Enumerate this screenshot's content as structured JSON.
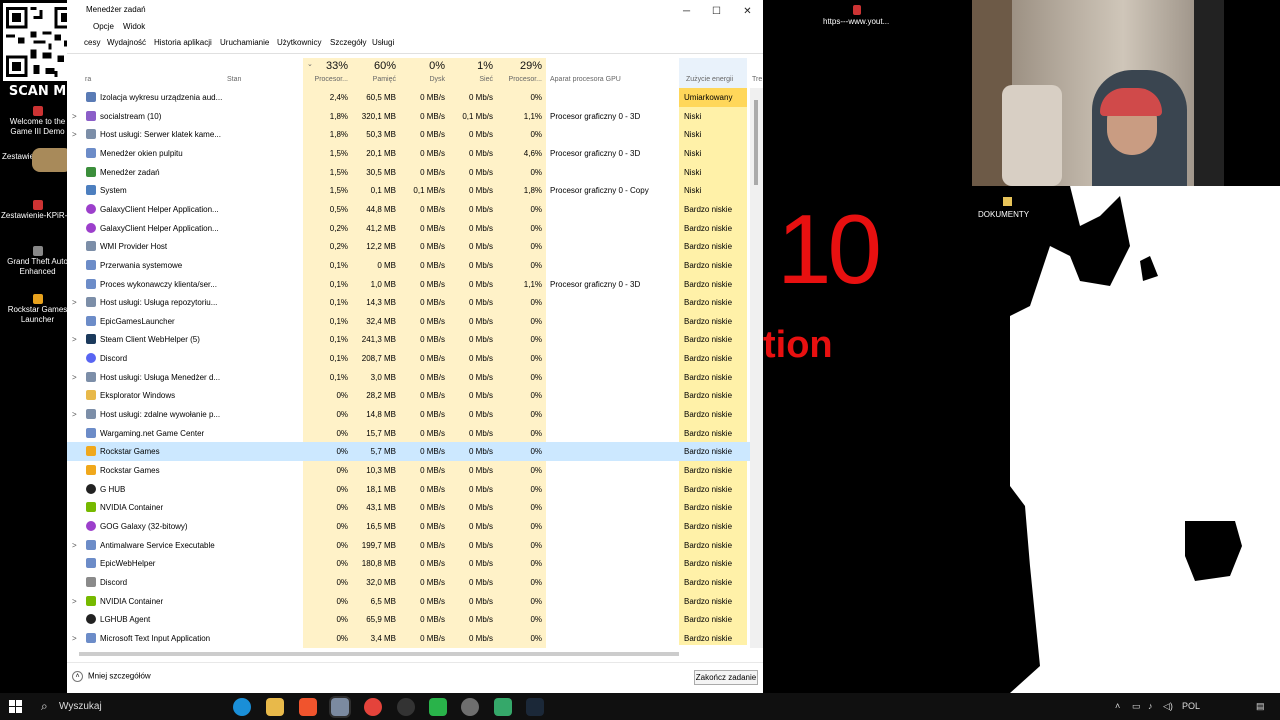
{
  "desktop": {
    "scan_text": "SCAN ME",
    "icons": [
      {
        "label": "Welcome to the Game III Demo"
      },
      {
        "label": "Zestawienie"
      },
      {
        "label": "Zestawienie-KPiR-..."
      },
      {
        "label": "Grand Theft Auto Enhanced"
      },
      {
        "label": "Rockstar Games Launcher"
      }
    ]
  },
  "window": {
    "title": "Menedżer zadań",
    "menu": [
      "Opcje",
      "Widok"
    ],
    "tabs": [
      "cesy",
      "Wydajność",
      "Historia aplikacji",
      "Uruchamianie",
      "Użytkownicy",
      "Szczegóły",
      "Usługi"
    ],
    "column_headers": {
      "name": "ra",
      "status": "Stan",
      "cpu_pct": "33%",
      "cpu": "Procesor...",
      "mem_pct": "60%",
      "mem": "Pamięć",
      "disk_pct": "0%",
      "disk": "Dysk",
      "net_pct": "1%",
      "net": "Sieć",
      "gpu_pct": "29%",
      "gpu": "Procesor...",
      "gpu_engine": "Aparat procesora GPU",
      "power": "Zużycie energii",
      "power2": "Tre"
    },
    "rows": [
      {
        "expand": "",
        "name": "Izolacja wykresu urządzenia aud...",
        "cpu": "2,4%",
        "mem": "60,5 MB",
        "disk": "0 MB/s",
        "net": "0 Mb/s",
        "gpu": "0%",
        "engine": "",
        "power": "Umiarkowany",
        "icon": "audio"
      },
      {
        "expand": ">",
        "name": "socialstream (10)",
        "cpu": "1,8%",
        "mem": "320,1 MB",
        "disk": "0 MB/s",
        "net": "0,1 Mb/s",
        "gpu": "1,1%",
        "engine": "Procesor graficzny 0 - 3D",
        "power": "Niski",
        "icon": "app"
      },
      {
        "expand": ">",
        "name": "Host usługi: Serwer klatek kame...",
        "cpu": "1,8%",
        "mem": "50,3 MB",
        "disk": "0 MB/s",
        "net": "0 Mb/s",
        "gpu": "0%",
        "engine": "",
        "power": "Niski",
        "icon": "service"
      },
      {
        "expand": "",
        "name": "Menedżer okien pulpitu",
        "cpu": "1,5%",
        "mem": "20,1 MB",
        "disk": "0 MB/s",
        "net": "0 Mb/s",
        "gpu": "4,6%",
        "engine": "Procesor graficzny 0 - 3D",
        "power": "Niski",
        "icon": "window"
      },
      {
        "expand": "",
        "name": "Menedżer zadań",
        "cpu": "1,5%",
        "mem": "30,5 MB",
        "disk": "0 MB/s",
        "net": "0 Mb/s",
        "gpu": "0%",
        "engine": "",
        "power": "Niski",
        "icon": "taskmgr"
      },
      {
        "expand": "",
        "name": "System",
        "cpu": "1,5%",
        "mem": "0,1 MB",
        "disk": "0,1 MB/s",
        "net": "0 Mb/s",
        "gpu": "1,8%",
        "engine": "Procesor graficzny 0 - Copy",
        "power": "Niski",
        "icon": "system"
      },
      {
        "expand": "",
        "name": "GalaxyClient Helper Application...",
        "cpu": "0,5%",
        "mem": "44,8 MB",
        "disk": "0 MB/s",
        "net": "0 Mb/s",
        "gpu": "0%",
        "engine": "",
        "power": "Bardzo niskie",
        "icon": "galaxy"
      },
      {
        "expand": "",
        "name": "GalaxyClient Helper Application...",
        "cpu": "0,2%",
        "mem": "41,2 MB",
        "disk": "0 MB/s",
        "net": "0 Mb/s",
        "gpu": "0%",
        "engine": "",
        "power": "Bardzo niskie",
        "icon": "galaxy"
      },
      {
        "expand": "",
        "name": "WMI Provider Host",
        "cpu": "0,2%",
        "mem": "12,2 MB",
        "disk": "0 MB/s",
        "net": "0 Mb/s",
        "gpu": "0%",
        "engine": "",
        "power": "Bardzo niskie",
        "icon": "service"
      },
      {
        "expand": "",
        "name": "Przerwania systemowe",
        "cpu": "0,1%",
        "mem": "0 MB",
        "disk": "0 MB/s",
        "net": "0 Mb/s",
        "gpu": "0%",
        "engine": "",
        "power": "Bardzo niskie",
        "icon": "window"
      },
      {
        "expand": "",
        "name": "Proces wykonawczy klienta/ser...",
        "cpu": "0,1%",
        "mem": "1,0 MB",
        "disk": "0 MB/s",
        "net": "0 Mb/s",
        "gpu": "1,1%",
        "engine": "Procesor graficzny 0 - 3D",
        "power": "Bardzo niskie",
        "icon": "window"
      },
      {
        "expand": ">",
        "name": "Host usługi: Usługa repozytoriu...",
        "cpu": "0,1%",
        "mem": "14,3 MB",
        "disk": "0 MB/s",
        "net": "0 Mb/s",
        "gpu": "0%",
        "engine": "",
        "power": "Bardzo niskie",
        "icon": "service"
      },
      {
        "expand": "",
        "name": "EpicGamesLauncher",
        "cpu": "0,1%",
        "mem": "32,4 MB",
        "disk": "0 MB/s",
        "net": "0 Mb/s",
        "gpu": "0%",
        "engine": "",
        "power": "Bardzo niskie",
        "icon": "window"
      },
      {
        "expand": ">",
        "name": "Steam Client WebHelper (5)",
        "cpu": "0,1%",
        "mem": "241,3 MB",
        "disk": "0 MB/s",
        "net": "0 Mb/s",
        "gpu": "0%",
        "engine": "",
        "power": "Bardzo niskie",
        "icon": "steam"
      },
      {
        "expand": "",
        "name": "Discord",
        "cpu": "0,1%",
        "mem": "208,7 MB",
        "disk": "0 MB/s",
        "net": "0 Mb/s",
        "gpu": "0%",
        "engine": "",
        "power": "Bardzo niskie",
        "icon": "discord"
      },
      {
        "expand": ">",
        "name": "Host usługi: Usługa Menedżer d...",
        "cpu": "0,1%",
        "mem": "3,0 MB",
        "disk": "0 MB/s",
        "net": "0 Mb/s",
        "gpu": "0%",
        "engine": "",
        "power": "Bardzo niskie",
        "icon": "service"
      },
      {
        "expand": "",
        "name": "Eksplorator Windows",
        "cpu": "0%",
        "mem": "28,2 MB",
        "disk": "0 MB/s",
        "net": "0 Mb/s",
        "gpu": "0%",
        "engine": "",
        "power": "Bardzo niskie",
        "icon": "folder"
      },
      {
        "expand": ">",
        "name": "Host usługi: zdalne wywołanie p...",
        "cpu": "0%",
        "mem": "14,8 MB",
        "disk": "0 MB/s",
        "net": "0 Mb/s",
        "gpu": "0%",
        "engine": "",
        "power": "Bardzo niskie",
        "icon": "service"
      },
      {
        "expand": "",
        "name": "Wargaming.net Game Center",
        "cpu": "0%",
        "mem": "15,7 MB",
        "disk": "0 MB/s",
        "net": "0 Mb/s",
        "gpu": "0%",
        "engine": "",
        "power": "Bardzo niskie",
        "icon": "window"
      },
      {
        "expand": "",
        "name": "Rockstar Games",
        "cpu": "0%",
        "mem": "5,7 MB",
        "disk": "0 MB/s",
        "net": "0 Mb/s",
        "gpu": "0%",
        "engine": "",
        "power": "Bardzo niskie",
        "icon": "rockstar",
        "selected": true
      },
      {
        "expand": "",
        "name": "Rockstar Games",
        "cpu": "0%",
        "mem": "10,3 MB",
        "disk": "0 MB/s",
        "net": "0 Mb/s",
        "gpu": "0%",
        "engine": "",
        "power": "Bardzo niskie",
        "icon": "rockstar"
      },
      {
        "expand": "",
        "name": "G HUB",
        "cpu": "0%",
        "mem": "18,1 MB",
        "disk": "0 MB/s",
        "net": "0 Mb/s",
        "gpu": "0%",
        "engine": "",
        "power": "Bardzo niskie",
        "icon": "ghub"
      },
      {
        "expand": "",
        "name": "NVIDIA Container",
        "cpu": "0%",
        "mem": "43,1 MB",
        "disk": "0 MB/s",
        "net": "0 Mb/s",
        "gpu": "0%",
        "engine": "",
        "power": "Bardzo niskie",
        "icon": "nvidia"
      },
      {
        "expand": "",
        "name": "GOG Galaxy (32-bitowy)",
        "cpu": "0%",
        "mem": "16,5 MB",
        "disk": "0 MB/s",
        "net": "0 Mb/s",
        "gpu": "0%",
        "engine": "",
        "power": "Bardzo niskie",
        "icon": "galaxy"
      },
      {
        "expand": ">",
        "name": "Antimalware Service Executable",
        "cpu": "0%",
        "mem": "199,7 MB",
        "disk": "0 MB/s",
        "net": "0 Mb/s",
        "gpu": "0%",
        "engine": "",
        "power": "Bardzo niskie",
        "icon": "window"
      },
      {
        "expand": "",
        "name": "EpicWebHelper",
        "cpu": "0%",
        "mem": "180,8 MB",
        "disk": "0 MB/s",
        "net": "0 Mb/s",
        "gpu": "0%",
        "engine": "",
        "power": "Bardzo niskie",
        "icon": "window"
      },
      {
        "expand": "",
        "name": "Discord",
        "cpu": "0%",
        "mem": "32,0 MB",
        "disk": "0 MB/s",
        "net": "0 Mb/s",
        "gpu": "0%",
        "engine": "",
        "power": "Bardzo niskie",
        "icon": "discordw"
      },
      {
        "expand": ">",
        "name": "NVIDIA Container",
        "cpu": "0%",
        "mem": "6,5 MB",
        "disk": "0 MB/s",
        "net": "0 Mb/s",
        "gpu": "0%",
        "engine": "",
        "power": "Bardzo niskie",
        "icon": "nvidia"
      },
      {
        "expand": "",
        "name": "LGHUB Agent",
        "cpu": "0%",
        "mem": "65,9 MB",
        "disk": "0 MB/s",
        "net": "0 Mb/s",
        "gpu": "0%",
        "engine": "",
        "power": "Bardzo niskie",
        "icon": "ghub"
      },
      {
        "expand": ">",
        "name": "Microsoft Text Input Application",
        "cpu": "0%",
        "mem": "3,4 MB",
        "disk": "0 MB/s",
        "net": "0 Mb/s",
        "gpu": "0%",
        "engine": "",
        "power": "Bardzo niskie",
        "icon": "window"
      }
    ],
    "footer": {
      "less_details": "Mniej szczegółów",
      "end_task": "Zakończ zadanie"
    }
  },
  "stream": {
    "url": "https---www.yout...",
    "big_number": "10",
    "red_text": "tion",
    "doc_label": "DOKUMENTY"
  },
  "taskbar": {
    "search": "Wyszukaj",
    "language": "POL"
  },
  "colors": {
    "highlight": "#fff2c8",
    "energy_moderate": "#ffd75a",
    "energy_low": "#fff1a8",
    "selected": "#cce8ff",
    "red": "#e81010"
  }
}
